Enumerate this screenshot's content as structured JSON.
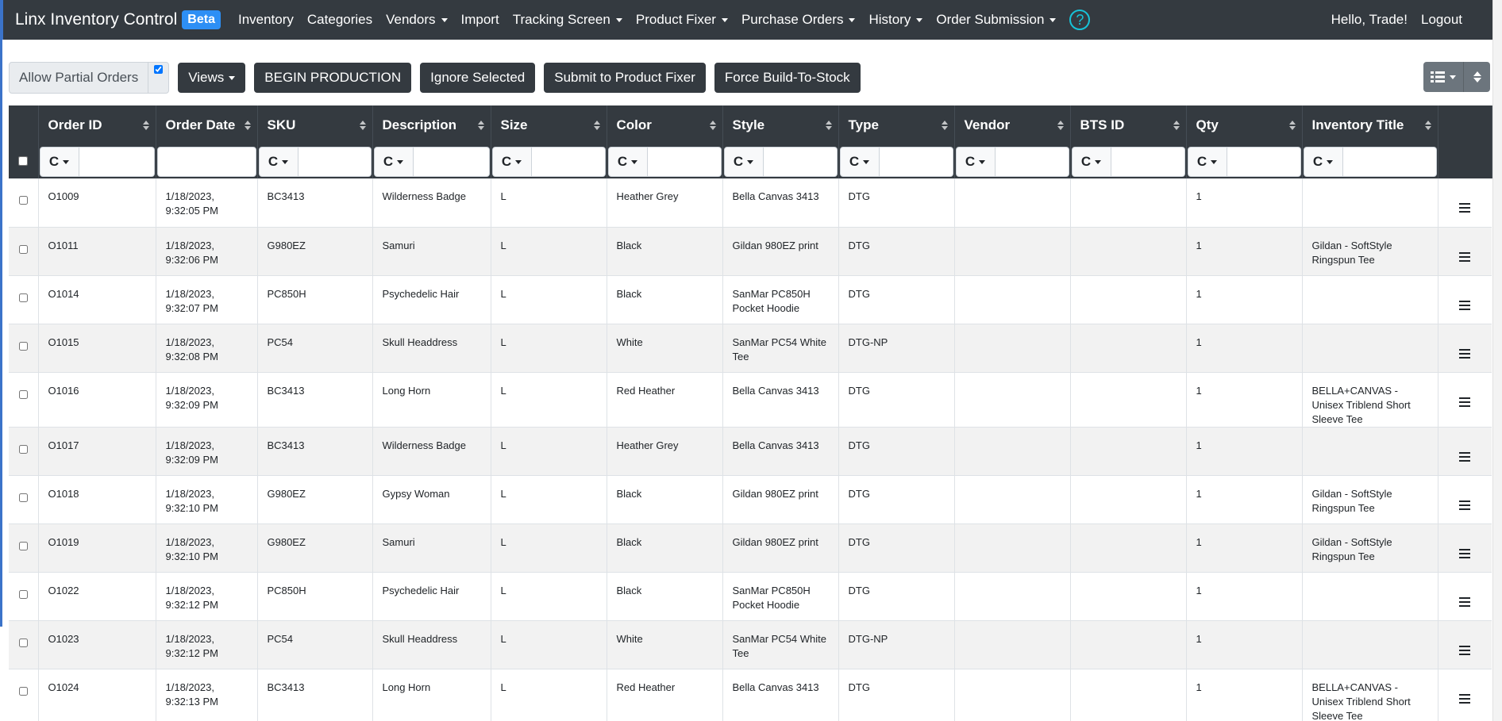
{
  "navbar": {
    "brand": "Linx Inventory Control",
    "badge": "Beta",
    "items": [
      {
        "label": "Inventory",
        "dropdown": false
      },
      {
        "label": "Categories",
        "dropdown": false
      },
      {
        "label": "Vendors",
        "dropdown": true
      },
      {
        "label": "Import",
        "dropdown": false
      },
      {
        "label": "Tracking Screen",
        "dropdown": true
      },
      {
        "label": "Product Fixer",
        "dropdown": true
      },
      {
        "label": "Purchase Orders",
        "dropdown": true
      },
      {
        "label": "History",
        "dropdown": true
      },
      {
        "label": "Order Submission",
        "dropdown": true
      }
    ],
    "help_icon": "?",
    "greeting": "Hello, Trade!",
    "logout": "Logout"
  },
  "toolbar": {
    "allow_partial_label": "Allow Partial Orders",
    "allow_partial_checked": true,
    "views_label": "Views",
    "begin_production_label": "BEGIN PRODUCTION",
    "ignore_selected_label": "Ignore Selected",
    "submit_fixer_label": "Submit to Product Fixer",
    "force_bts_label": "Force Build-To-Stock"
  },
  "view_toggle": {
    "list_icon": "list-icon",
    "sort_icon": "sort-icon"
  },
  "table": {
    "filter_button": "C",
    "columns": [
      {
        "label": "Order ID",
        "filter": "button"
      },
      {
        "label": "Order Date",
        "filter": "input"
      },
      {
        "label": "SKU",
        "filter": "button"
      },
      {
        "label": "Description",
        "filter": "button"
      },
      {
        "label": "Size",
        "filter": "button"
      },
      {
        "label": "Color",
        "filter": "button"
      },
      {
        "label": "Style",
        "filter": "button"
      },
      {
        "label": "Type",
        "filter": "button"
      },
      {
        "label": "Vendor",
        "filter": "button"
      },
      {
        "label": "BTS ID",
        "filter": "button"
      },
      {
        "label": "Qty",
        "filter": "button"
      },
      {
        "label": "Inventory Title",
        "filter": "button"
      }
    ],
    "rows": [
      [
        "O1009",
        "1/18/2023, 9:32:05 PM",
        "BC3413",
        "Wilderness Badge",
        "L",
        "Heather Grey",
        "Bella Canvas 3413",
        "DTG",
        "",
        "",
        "1",
        ""
      ],
      [
        "O1011",
        "1/18/2023, 9:32:06 PM",
        "G980EZ",
        "Samuri",
        "L",
        "Black",
        "Gildan 980EZ print",
        "DTG",
        "",
        "",
        "1",
        "Gildan - SoftStyle Ringspun Tee"
      ],
      [
        "O1014",
        "1/18/2023, 9:32:07 PM",
        "PC850H",
        "Psychedelic Hair",
        "L",
        "Black",
        "SanMar PC850H Pocket Hoodie",
        "DTG",
        "",
        "",
        "1",
        ""
      ],
      [
        "O1015",
        "1/18/2023, 9:32:08 PM",
        "PC54",
        "Skull Headdress",
        "L",
        "White",
        "SanMar PC54 White Tee",
        "DTG-NP",
        "",
        "",
        "1",
        ""
      ],
      [
        "O1016",
        "1/18/2023, 9:32:09 PM",
        "BC3413",
        "Long Horn",
        "L",
        "Red Heather",
        "Bella Canvas 3413",
        "DTG",
        "",
        "",
        "1",
        "BELLA+CANVAS - Unisex Triblend Short Sleeve Tee"
      ],
      [
        "O1017",
        "1/18/2023, 9:32:09 PM",
        "BC3413",
        "Wilderness Badge",
        "L",
        "Heather Grey",
        "Bella Canvas 3413",
        "DTG",
        "",
        "",
        "1",
        ""
      ],
      [
        "O1018",
        "1/18/2023, 9:32:10 PM",
        "G980EZ",
        "Gypsy Woman",
        "L",
        "Black",
        "Gildan 980EZ print",
        "DTG",
        "",
        "",
        "1",
        "Gildan - SoftStyle Ringspun Tee"
      ],
      [
        "O1019",
        "1/18/2023, 9:32:10 PM",
        "G980EZ",
        "Samuri",
        "L",
        "Black",
        "Gildan 980EZ print",
        "DTG",
        "",
        "",
        "1",
        "Gildan - SoftStyle Ringspun Tee"
      ],
      [
        "O1022",
        "1/18/2023, 9:32:12 PM",
        "PC850H",
        "Psychedelic Hair",
        "L",
        "Black",
        "SanMar PC850H Pocket Hoodie",
        "DTG",
        "",
        "",
        "1",
        ""
      ],
      [
        "O1023",
        "1/18/2023, 9:32:12 PM",
        "PC54",
        "Skull Headdress",
        "L",
        "White",
        "SanMar PC54 White Tee",
        "DTG-NP",
        "",
        "",
        "1",
        ""
      ],
      [
        "O1024",
        "1/18/2023, 9:32:13 PM",
        "BC3413",
        "Long Horn",
        "L",
        "Red Heather",
        "Bella Canvas 3413",
        "DTG",
        "",
        "",
        "1",
        "BELLA+CANVAS - Unisex Triblend Short Sleeve Tee"
      ]
    ]
  },
  "colors": {
    "navbar_bg": "#343a40",
    "badge_bg": "#2d8ff5",
    "help_icon": "#17c3d8",
    "stripe": "#f2f2f2"
  }
}
